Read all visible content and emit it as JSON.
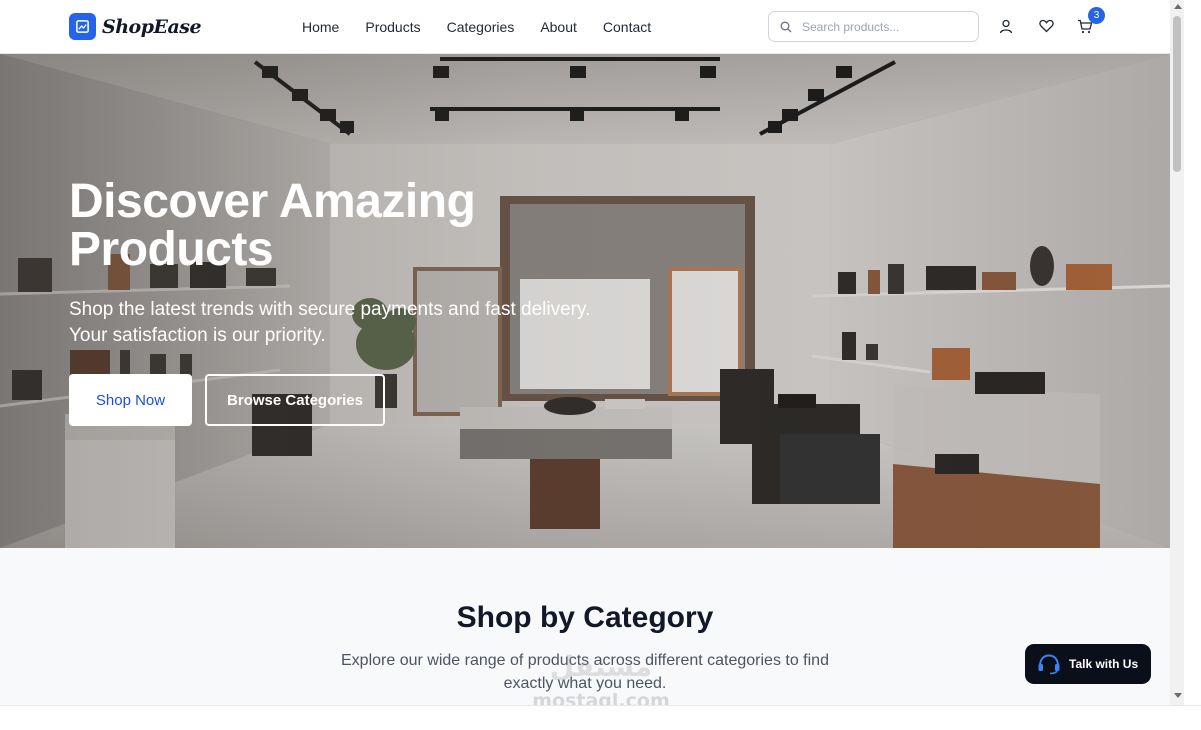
{
  "brand": {
    "name": "ShopEase",
    "accent": "#2563eb"
  },
  "nav": [
    {
      "label": "Home"
    },
    {
      "label": "Products"
    },
    {
      "label": "Categories"
    },
    {
      "label": "About"
    },
    {
      "label": "Contact"
    }
  ],
  "search": {
    "placeholder": "Search products...",
    "value": ""
  },
  "header_icons": [
    "user-icon",
    "heart-icon",
    "cart-icon"
  ],
  "cart": {
    "count": "3"
  },
  "hero": {
    "title": "Discover Amazing Products",
    "subtitle": "Shop the latest trends with secure payments and fast delivery. Your satisfaction is our priority.",
    "primary_button": "Shop Now",
    "secondary_button": "Browse Categories"
  },
  "categories_section": {
    "title": "Shop by Category",
    "subtitle": "Explore our wide range of products across different categories to find exactly what you need."
  },
  "chat": {
    "label": "Talk with Us",
    "icon": "headset-icon"
  },
  "watermark": {
    "arabic": "مستقل",
    "latin": "mostaql.com"
  }
}
